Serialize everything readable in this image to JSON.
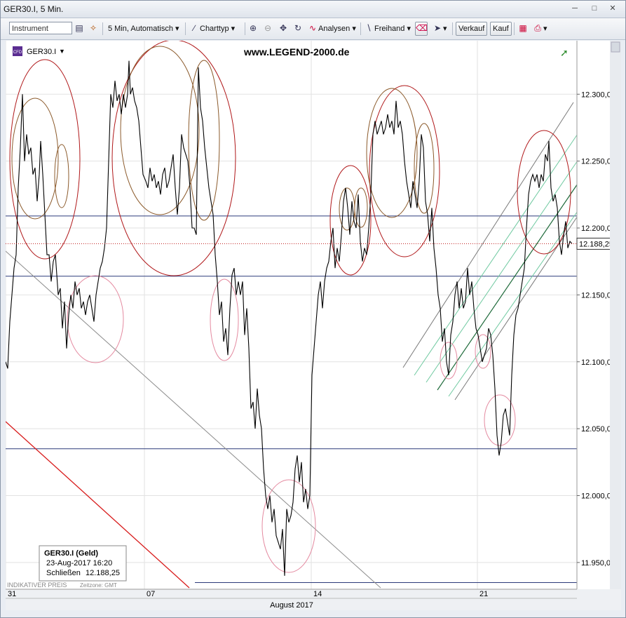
{
  "window": {
    "title": "GER30.I, 5 Min."
  },
  "toolbar": {
    "instrument_placeholder": "Instrument",
    "interval": "5 Min,  Automatisch",
    "charttyp": "Charttyp",
    "analysen": "Analysen",
    "freihand": "Freihand",
    "verkauf": "Verkauf",
    "kauf": "Kauf"
  },
  "chart_header": {
    "symbol": "GER30.I",
    "watermark": "www.LEGEND-2000.de",
    "cfd_badge": "CFD"
  },
  "info_box": {
    "title": "GER30.I (Geld)",
    "datetime": "23-Aug-2017 16:20",
    "close_label": "Schließen",
    "close_value": "12.188,25"
  },
  "footer": {
    "indicative": "INDIKATIVER PREIS",
    "timezone": "Zeitzone: GMT",
    "month": "August 2017"
  },
  "chart_data": {
    "type": "line",
    "x_ticks": [
      "31",
      "07",
      "14",
      "21"
    ],
    "ylim": [
      11930,
      12340
    ],
    "y_ticks": [
      "11.950,00",
      "12.000,00",
      "12.050,00",
      "12.100,00",
      "12.150,00",
      "12.200,00",
      "12.250,00",
      "12.300,00"
    ],
    "y_tick_values": [
      11950,
      12000,
      12050,
      12100,
      12150,
      12200,
      12250,
      12300
    ],
    "last_price": "12.188,25",
    "last_value": 12188.25,
    "horizontal_levels": [
      12209,
      12164,
      12035,
      11935
    ],
    "series": [
      {
        "values": [
          [
            0,
            12100
          ],
          [
            3,
            12095
          ],
          [
            6,
            12130
          ],
          [
            9,
            12150
          ],
          [
            12,
            12170
          ],
          [
            15,
            12180
          ],
          [
            18,
            12230
          ],
          [
            21,
            12260
          ],
          [
            24,
            12300
          ],
          [
            27,
            12250
          ],
          [
            30,
            12270
          ],
          [
            33,
            12255
          ],
          [
            36,
            12260
          ],
          [
            39,
            12240
          ],
          [
            42,
            12245
          ],
          [
            45,
            12220
          ],
          [
            48,
            12240
          ],
          [
            50,
            12265
          ],
          [
            53,
            12240
          ],
          [
            56,
            12210
          ],
          [
            59,
            12180
          ],
          [
            62,
            12180
          ],
          [
            65,
            12160
          ],
          [
            68,
            12175
          ],
          [
            71,
            12180
          ],
          [
            75,
            12150
          ],
          [
            78,
            12155
          ],
          [
            81,
            12125
          ],
          [
            84,
            12145
          ],
          [
            87,
            12110
          ],
          [
            90,
            12135
          ],
          [
            93,
            12150
          ],
          [
            96,
            12140
          ],
          [
            99,
            12160
          ],
          [
            102,
            12150
          ],
          [
            105,
            12155
          ],
          [
            108,
            12140
          ],
          [
            111,
            12145
          ],
          [
            114,
            12135
          ],
          [
            117,
            12145
          ],
          [
            120,
            12150
          ],
          [
            123,
            12140
          ],
          [
            126,
            12130
          ],
          [
            129,
            12150
          ],
          [
            132,
            12160
          ],
          [
            135,
            12170
          ],
          [
            138,
            12175
          ],
          [
            141,
            12185
          ],
          [
            144,
            12200
          ],
          [
            147,
            12250
          ],
          [
            150,
            12300
          ],
          [
            153,
            12290
          ],
          [
            156,
            12310
          ],
          [
            159,
            12295
          ],
          [
            162,
            12300
          ],
          [
            165,
            12285
          ],
          [
            168,
            12300
          ],
          [
            171,
            12290
          ],
          [
            174,
            12300
          ],
          [
            176,
            12325
          ],
          [
            178,
            12300
          ],
          [
            181,
            12305
          ],
          [
            184,
            12295
          ],
          [
            187,
            12290
          ],
          [
            190,
            12280
          ],
          [
            193,
            12260
          ],
          [
            196,
            12240
          ],
          [
            200,
            12235
          ],
          [
            203,
            12230
          ],
          [
            206,
            12245
          ],
          [
            209,
            12235
          ],
          [
            212,
            12240
          ],
          [
            215,
            12230
          ],
          [
            218,
            12235
          ],
          [
            221,
            12225
          ],
          [
            224,
            12240
          ],
          [
            227,
            12245
          ],
          [
            230,
            12230
          ],
          [
            233,
            12235
          ],
          [
            236,
            12245
          ],
          [
            239,
            12255
          ],
          [
            242,
            12230
          ],
          [
            245,
            12210
          ],
          [
            248,
            12230
          ],
          [
            251,
            12270
          ],
          [
            254,
            12260
          ],
          [
            257,
            12255
          ],
          [
            260,
            12250
          ],
          [
            263,
            12230
          ],
          [
            266,
            12200
          ],
          [
            269,
            12200
          ],
          [
            272,
            12195
          ],
          [
            275,
            12320
          ],
          [
            278,
            12290
          ],
          [
            281,
            12280
          ],
          [
            284,
            12260
          ],
          [
            287,
            12245
          ],
          [
            290,
            12230
          ],
          [
            293,
            12220
          ],
          [
            296,
            12210
          ],
          [
            299,
            12180
          ],
          [
            302,
            12160
          ],
          [
            305,
            12135
          ],
          [
            308,
            12145
          ],
          [
            311,
            12115
          ],
          [
            314,
            12125
          ],
          [
            317,
            12105
          ],
          [
            320,
            12140
          ],
          [
            323,
            12165
          ],
          [
            326,
            12170
          ],
          [
            329,
            12150
          ],
          [
            332,
            12160
          ],
          [
            335,
            12150
          ],
          [
            338,
            12160
          ],
          [
            341,
            12120
          ],
          [
            344,
            12140
          ],
          [
            347,
            12110
          ],
          [
            350,
            12065
          ],
          [
            353,
            12070
          ],
          [
            356,
            12050
          ],
          [
            359,
            12080
          ],
          [
            362,
            12060
          ],
          [
            365,
            12050
          ],
          [
            368,
            12020
          ],
          [
            371,
            12000
          ],
          [
            374,
            11990
          ],
          [
            377,
            12000
          ],
          [
            380,
            11980
          ],
          [
            383,
            11990
          ],
          [
            386,
            11970
          ],
          [
            389,
            11965
          ],
          [
            392,
            11960
          ],
          [
            395,
            11975
          ],
          [
            398,
            11940
          ],
          [
            401,
            11990
          ],
          [
            404,
            11980
          ],
          [
            407,
            11985
          ],
          [
            410,
            11995
          ],
          [
            413,
            12020
          ],
          [
            416,
            12030
          ],
          [
            419,
            12010
          ],
          [
            422,
            12025
          ],
          [
            425,
            11995
          ],
          [
            428,
            12005
          ],
          [
            431,
            11990
          ],
          [
            434,
            12000
          ],
          [
            437,
            12090
          ],
          [
            440,
            12110
          ],
          [
            443,
            12130
          ],
          [
            446,
            12150
          ],
          [
            449,
            12160
          ],
          [
            452,
            12140
          ],
          [
            455,
            12160
          ],
          [
            458,
            12170
          ],
          [
            461,
            12175
          ],
          [
            464,
            12190
          ],
          [
            467,
            12200
          ],
          [
            470,
            12170
          ],
          [
            473,
            12185
          ],
          [
            476,
            12175
          ],
          [
            479,
            12195
          ],
          [
            482,
            12220
          ],
          [
            485,
            12230
          ],
          [
            488,
            12215
          ],
          [
            491,
            12195
          ],
          [
            494,
            12220
          ],
          [
            497,
            12205
          ],
          [
            500,
            12200
          ],
          [
            503,
            12225
          ],
          [
            506,
            12190
          ],
          [
            509,
            12175
          ],
          [
            512,
            12185
          ],
          [
            515,
            12180
          ],
          [
            518,
            12200
          ],
          [
            521,
            12225
          ],
          [
            524,
            12270
          ],
          [
            527,
            12280
          ],
          [
            530,
            12270
          ],
          [
            533,
            12275
          ],
          [
            536,
            12280
          ],
          [
            539,
            12270
          ],
          [
            542,
            12275
          ],
          [
            545,
            12285
          ],
          [
            548,
            12275
          ],
          [
            551,
            12280
          ],
          [
            554,
            12270
          ],
          [
            557,
            12295
          ],
          [
            560,
            12275
          ],
          [
            563,
            12280
          ],
          [
            566,
            12270
          ],
          [
            569,
            12250
          ],
          [
            572,
            12235
          ],
          [
            575,
            12225
          ],
          [
            578,
            12215
          ],
          [
            581,
            12235
          ],
          [
            584,
            12225
          ],
          [
            587,
            12215
          ],
          [
            590,
            12235
          ],
          [
            593,
            12270
          ],
          [
            596,
            12260
          ],
          [
            599,
            12220
          ],
          [
            602,
            12210
          ],
          [
            605,
            12190
          ],
          [
            608,
            12215
          ],
          [
            611,
            12185
          ],
          [
            614,
            12170
          ],
          [
            617,
            12150
          ],
          [
            620,
            12140
          ],
          [
            623,
            12115
          ],
          [
            626,
            12125
          ],
          [
            629,
            12100
          ],
          [
            632,
            12090
          ],
          [
            635,
            12120
          ],
          [
            638,
            12130
          ],
          [
            641,
            12150
          ],
          [
            644,
            12160
          ],
          [
            647,
            12140
          ],
          [
            650,
            12155
          ],
          [
            653,
            12140
          ],
          [
            656,
            12145
          ],
          [
            659,
            12170
          ],
          [
            662,
            12150
          ],
          [
            665,
            12160
          ],
          [
            668,
            12140
          ],
          [
            671,
            12125
          ],
          [
            674,
            12120
          ],
          [
            677,
            12110
          ],
          [
            680,
            12100
          ],
          [
            683,
            12105
          ],
          [
            686,
            12110
          ],
          [
            689,
            12125
          ],
          [
            692,
            12120
          ],
          [
            695,
            12105
          ],
          [
            698,
            12080
          ],
          [
            701,
            12045
          ],
          [
            704,
            12030
          ],
          [
            707,
            12040
          ],
          [
            710,
            12060
          ],
          [
            713,
            12065
          ],
          [
            716,
            12055
          ],
          [
            719,
            12045
          ],
          [
            722,
            12090
          ],
          [
            725,
            12120
          ],
          [
            728,
            12135
          ],
          [
            731,
            12140
          ],
          [
            734,
            12150
          ],
          [
            737,
            12160
          ],
          [
            740,
            12170
          ],
          [
            743,
            12200
          ],
          [
            746,
            12225
          ],
          [
            749,
            12235
          ],
          [
            752,
            12240
          ],
          [
            755,
            12235
          ],
          [
            758,
            12240
          ],
          [
            761,
            12230
          ],
          [
            764,
            12240
          ],
          [
            767,
            12235
          ],
          [
            770,
            12255
          ],
          [
            773,
            12250
          ],
          [
            775,
            12265
          ],
          [
            778,
            12230
          ],
          [
            781,
            12220
          ],
          [
            784,
            12225
          ],
          [
            787,
            12215
          ],
          [
            790,
            12190
          ],
          [
            793,
            12180
          ],
          [
            796,
            12195
          ],
          [
            799,
            12205
          ],
          [
            802,
            12185
          ],
          [
            805,
            12190
          ],
          [
            808,
            12188.25
          ]
        ]
      }
    ]
  }
}
